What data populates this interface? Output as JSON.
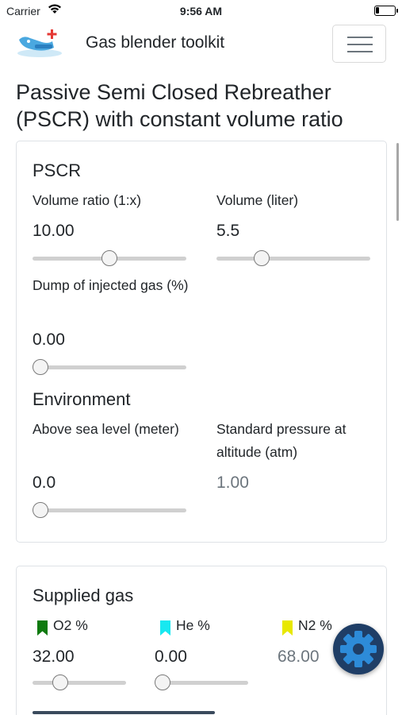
{
  "status_bar": {
    "carrier": "Carrier",
    "time": "9:56 AM"
  },
  "navbar": {
    "brand": "Gas blender toolkit"
  },
  "page": {
    "title": "Passive Semi Closed Rebreather (PSCR) with constant volume ratio"
  },
  "pscr": {
    "heading": "PSCR",
    "volume_ratio": {
      "label": "Volume ratio (1:x)",
      "value": "10.00",
      "slider_fraction": 0.5
    },
    "volume": {
      "label": "Volume (liter)",
      "value": "5.5",
      "slider_fraction": 0.27
    },
    "dump": {
      "label": "Dump of injected gas (%)",
      "value": "0.00",
      "slider_fraction": 0.0
    }
  },
  "environment": {
    "heading": "Environment",
    "altitude": {
      "label": "Above sea level (meter)",
      "value": "0.0",
      "slider_fraction": 0.0
    },
    "pressure": {
      "label": "Standard pressure at altitude (atm)",
      "value": "1.00"
    }
  },
  "supplied_gas": {
    "heading": "Supplied gas",
    "o2": {
      "label": "O2 %",
      "value": "32.00",
      "slider_fraction": 0.25,
      "color": "#0f7a0f"
    },
    "he": {
      "label": "He %",
      "value": "0.00",
      "slider_fraction": 0.0,
      "color": "#18e8f0"
    },
    "n2": {
      "label": "N2 %",
      "value": "68.00",
      "color": "#e8e800"
    }
  },
  "colors": {
    "fab": "#1f3e66",
    "fab_gear": "#2d8bd8",
    "muted_text": "#6c757d"
  },
  "icons": [
    "wifi-icon",
    "battery-icon",
    "app-logo-icon",
    "hamburger-icon",
    "tag-icon",
    "gear-icon"
  ]
}
